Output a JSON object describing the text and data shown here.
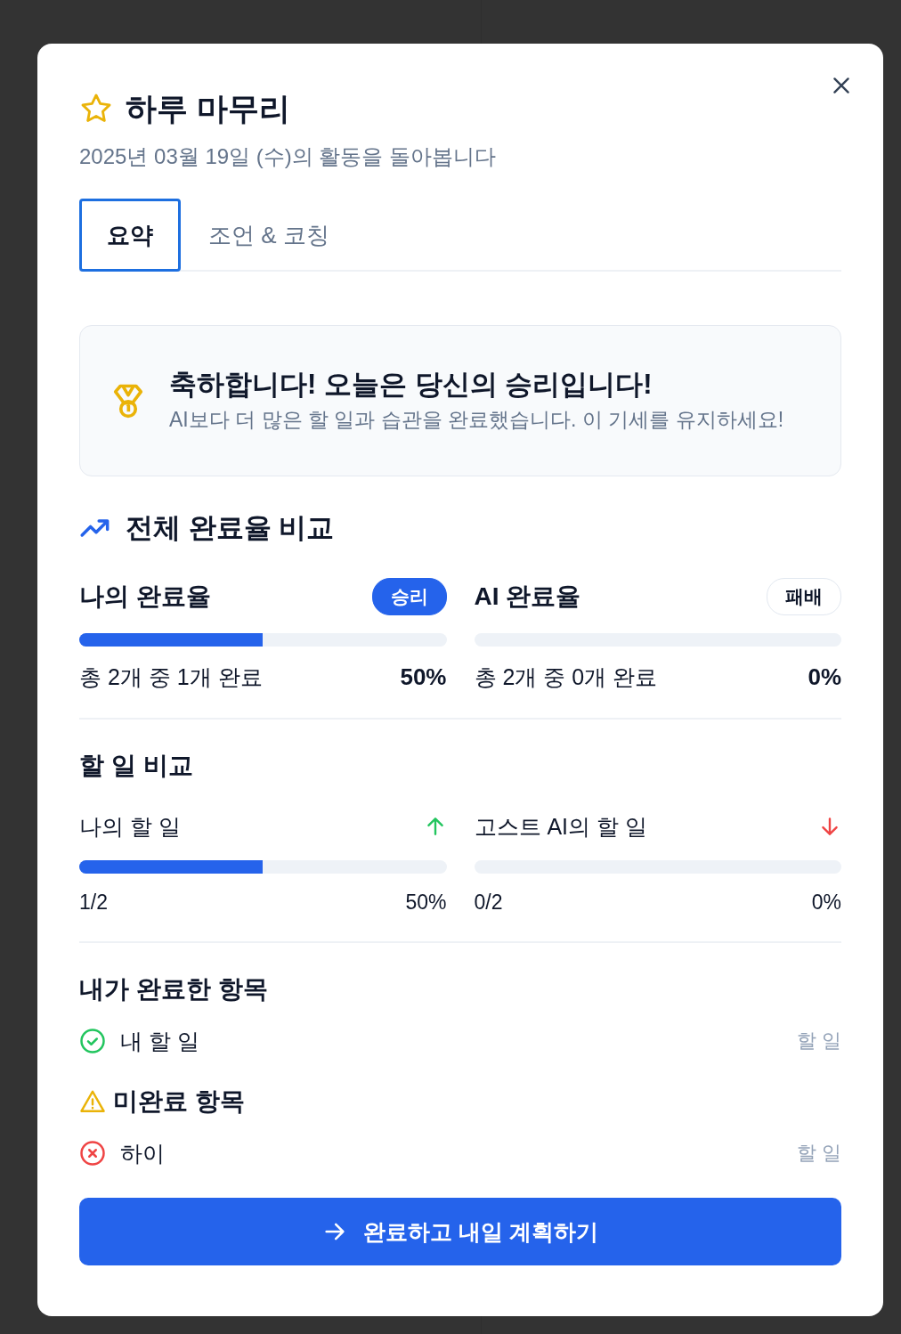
{
  "dialog": {
    "title": "하루 마무리",
    "subtitle": "2025년 03월 19일 (수)의 활동을 돌아봅니다"
  },
  "tabs": [
    {
      "label": "요약",
      "selected": true
    },
    {
      "label": "조언 & 코칭",
      "selected": false
    }
  ],
  "banner": {
    "title": "축하합니다! 오늘은 당신의 승리입니다!",
    "message": "AI보다 더 많은 할 일과 습관을 완료했습니다. 이 기세를 유지하세요!"
  },
  "overall": {
    "title": "전체 완료율 비교",
    "cards": [
      {
        "label": "나의 완료율",
        "badge": "승리",
        "won": true,
        "level": 0.5,
        "detail": "총 2개 중 1개 완료",
        "percent": "50%"
      },
      {
        "label": "AI 완료율",
        "badge": "패배",
        "won": false,
        "level": 0,
        "detail": "총 2개 중 0개 완료",
        "percent": "0%"
      }
    ]
  },
  "todo": {
    "title": "할 일 비교",
    "cards": [
      {
        "label": "나의 할 일",
        "up": true,
        "level": 0.5,
        "count": "1/2",
        "percent": "50%"
      },
      {
        "label": "고스트 AI의 할 일",
        "up": false,
        "level": 0,
        "count": "0/2",
        "percent": "0%"
      }
    ]
  },
  "completed": {
    "title": "내가 완료한 항목",
    "items": [
      {
        "name": "내 할 일",
        "type": "할 일",
        "done": true
      }
    ]
  },
  "incomplete": {
    "title": "미완료 항목",
    "items": [
      {
        "name": "하이",
        "type": "할 일",
        "done": false
      }
    ]
  },
  "action": {
    "label": "완료하고 내일 계획하기"
  }
}
